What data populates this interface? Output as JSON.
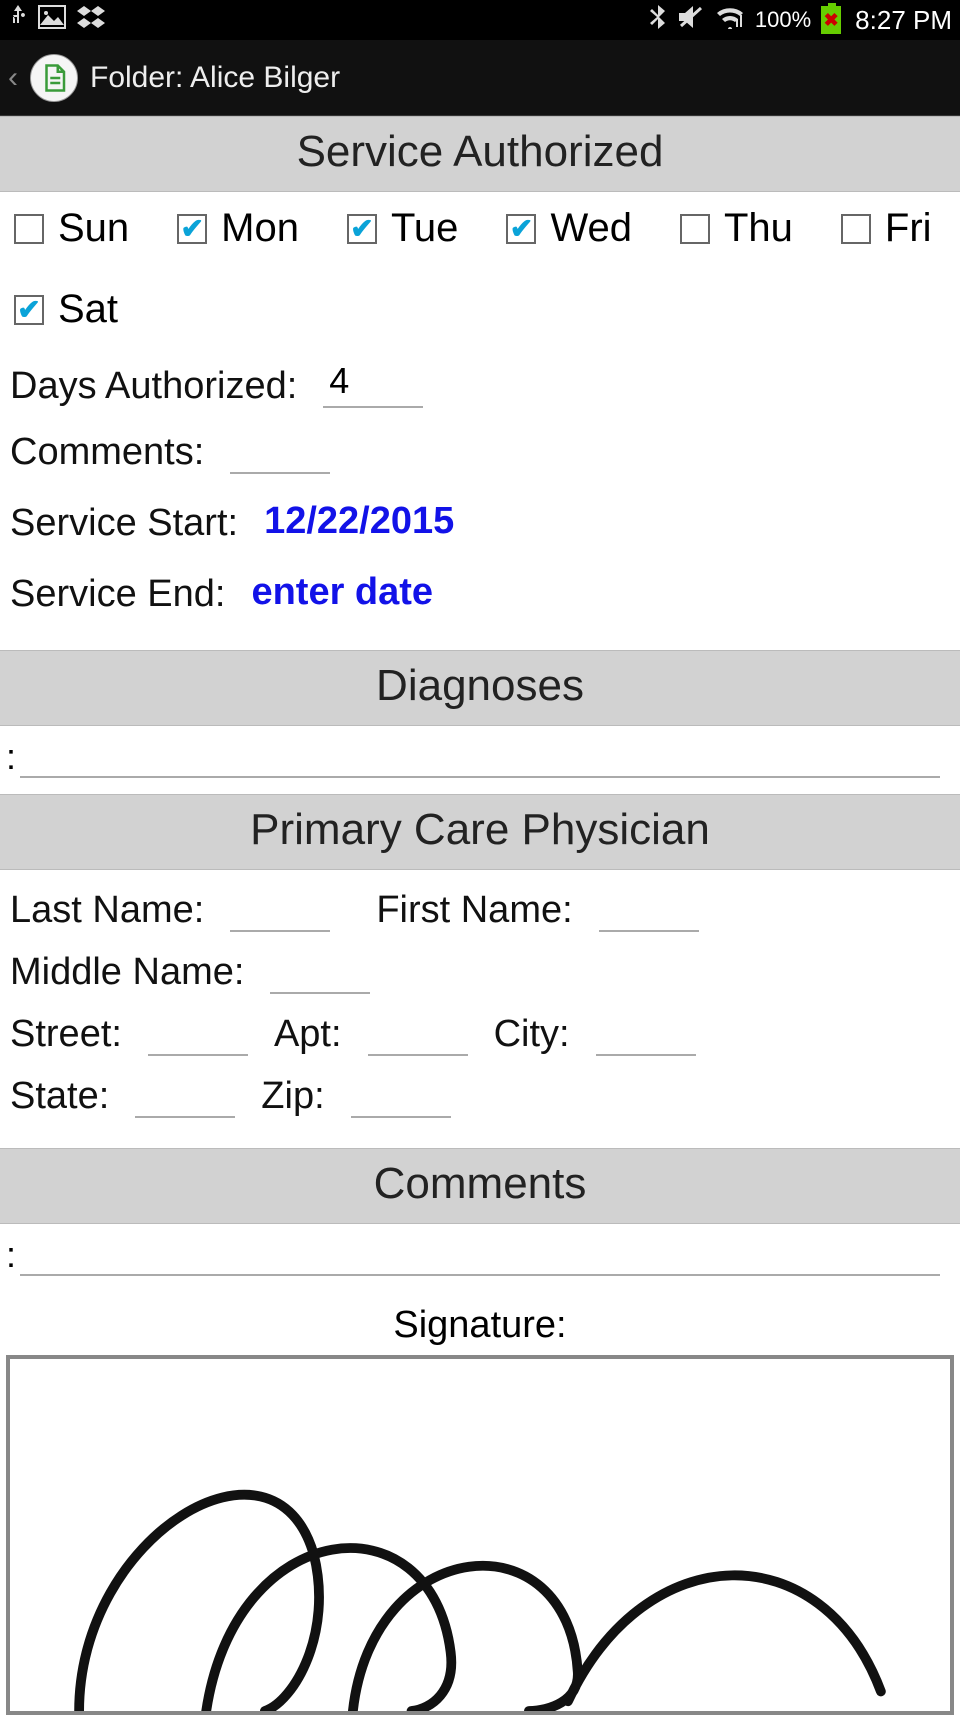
{
  "status": {
    "battery_pct": "100%",
    "time": "8:27 PM"
  },
  "app_bar": {
    "title": "Folder: Alice Bilger"
  },
  "sections": {
    "service_authorized": {
      "title": "Service Authorized",
      "days": [
        {
          "label": "Sun",
          "checked": false
        },
        {
          "label": "Mon",
          "checked": true
        },
        {
          "label": "Tue",
          "checked": true
        },
        {
          "label": "Wed",
          "checked": true
        },
        {
          "label": "Thu",
          "checked": false
        },
        {
          "label": "Fri",
          "checked": false
        },
        {
          "label": "Sat",
          "checked": true
        }
      ],
      "days_authorized_label": "Days Authorized:",
      "days_authorized_value": "4",
      "comments_label": "Comments:",
      "comments_value": "",
      "service_start_label": "Service Start:",
      "service_start_value": "12/22/2015",
      "service_end_label": "Service End:",
      "service_end_value": "enter date"
    },
    "diagnoses": {
      "title": "Diagnoses",
      "prefix": ":",
      "value": ""
    },
    "pcp": {
      "title": "Primary Care Physician",
      "last_name_label": "Last Name:",
      "last_name_value": "",
      "first_name_label": "First Name:",
      "first_name_value": "",
      "middle_name_label": "Middle Name:",
      "middle_name_value": "",
      "street_label": "Street:",
      "street_value": "",
      "apt_label": "Apt:",
      "apt_value": "",
      "city_label": "City:",
      "city_value": "",
      "state_label": "State:",
      "state_value": "",
      "zip_label": "Zip:",
      "zip_value": ""
    },
    "comments": {
      "title": "Comments",
      "prefix": ":",
      "value": ""
    },
    "signature": {
      "label": "Signature:"
    }
  }
}
